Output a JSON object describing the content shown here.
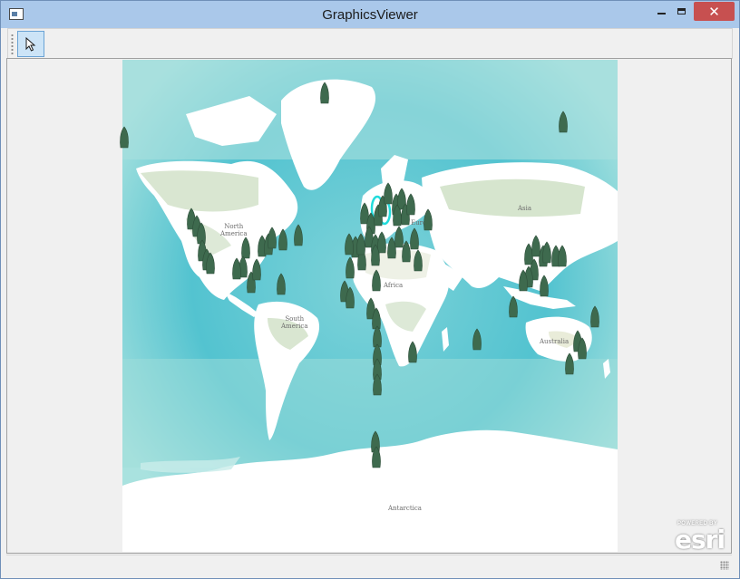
{
  "window": {
    "title": "GraphicsViewer",
    "close_glyph": "✕",
    "buttons": [
      "minimize-icon",
      "maximize-icon",
      "close-icon"
    ]
  },
  "toolbar": {
    "tools": [
      {
        "name": "select-pointer-tool",
        "icon": "cursor-arrow-icon",
        "selected": true
      }
    ]
  },
  "map": {
    "ocean_color": "#8fd9dc",
    "land_color": "#ffffff",
    "vegetation_color": "#c9dcc0",
    "labels": {
      "north_america": "North\nAmerica",
      "south_america": "South\nAmerica",
      "europe": "Euro",
      "africa": "Africa",
      "asia": "Asia",
      "australia": "Australia",
      "antarctica": "Antarctica"
    },
    "marker_icon": "rocket-pin-icon",
    "marker_color": "#3e6a4e",
    "selection_color": "#22dcdc",
    "attribution": {
      "small": "POWERED BY",
      "big": "esri"
    }
  }
}
